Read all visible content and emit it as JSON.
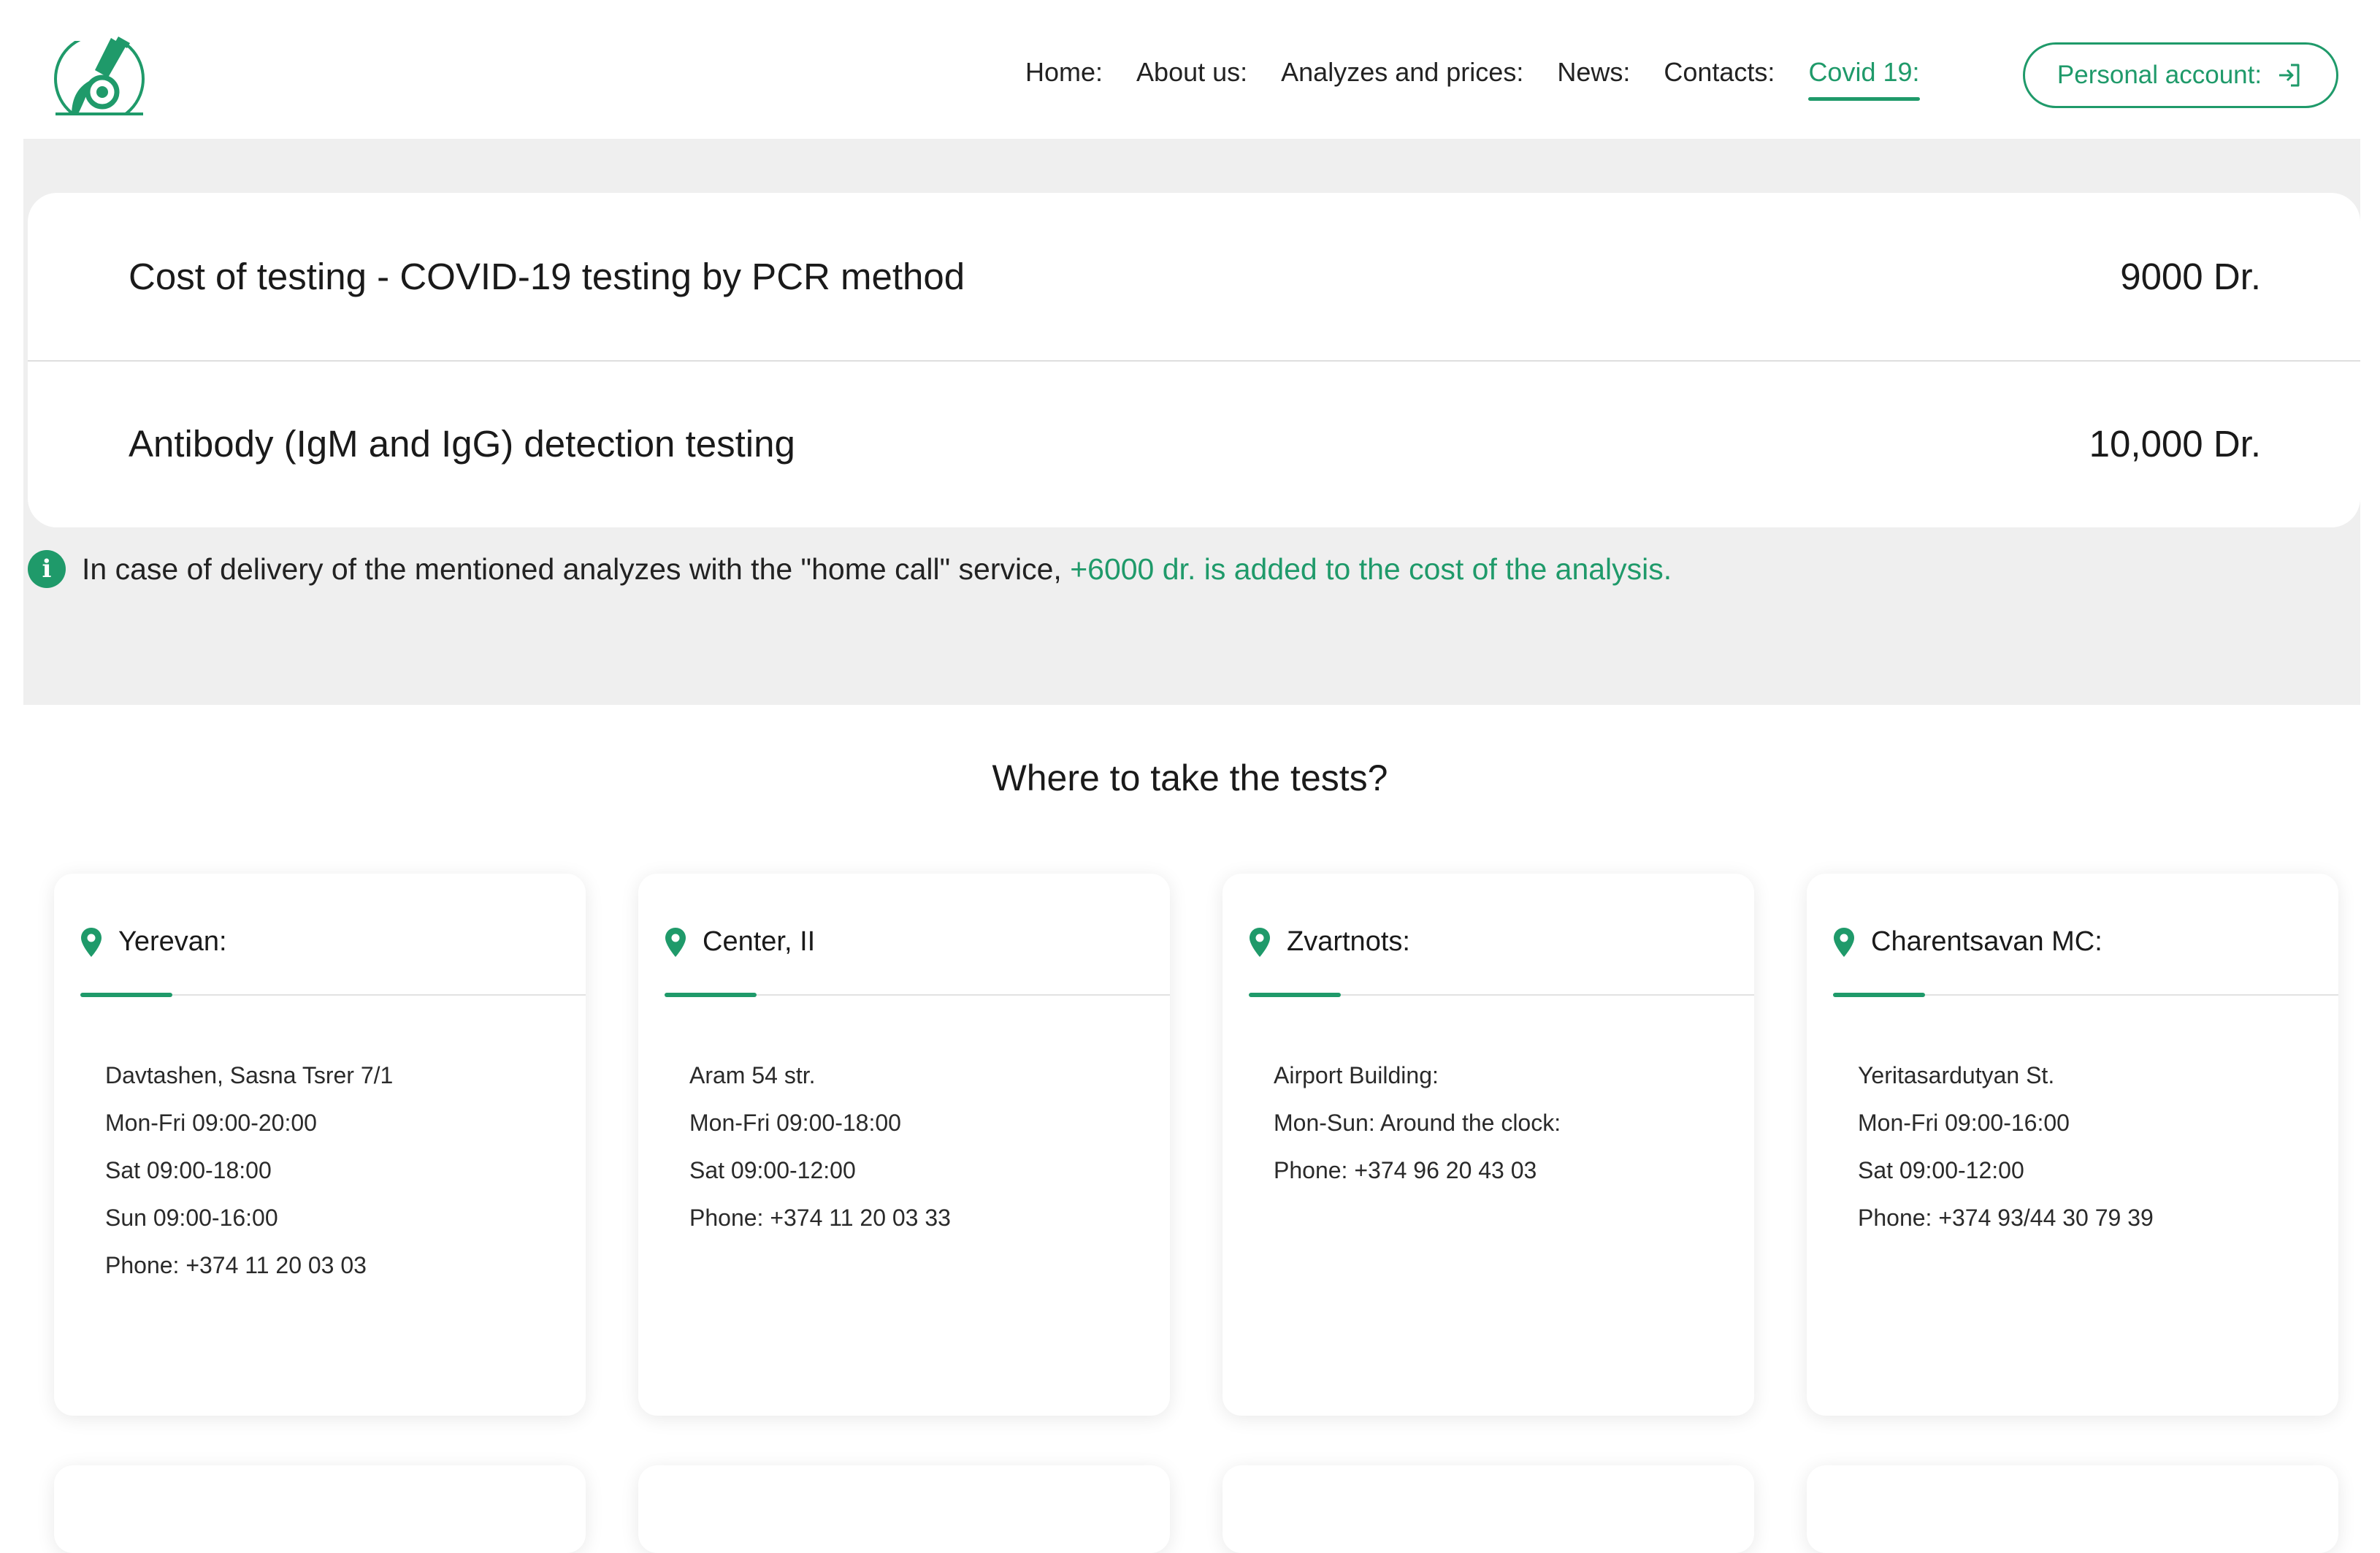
{
  "nav": {
    "items": [
      {
        "label": "Home:"
      },
      {
        "label": "About us:"
      },
      {
        "label": "Analyzes and prices:"
      },
      {
        "label": "News:"
      },
      {
        "label": "Contacts:"
      },
      {
        "label": "Covid 19:",
        "active": true
      }
    ],
    "account_label": "Personal account:"
  },
  "pricing": {
    "rows": [
      {
        "name": "Cost of testing - COVID-19 testing by PCR method",
        "price": "9000 Dr."
      },
      {
        "name": "Antibody (IgM and IgG) detection testing",
        "price": "10,000 Dr."
      }
    ],
    "note_text": "In case of delivery of the mentioned analyzes with the \"home call\" service,",
    "note_accent": "+6000 dr. is added to the cost of the analysis."
  },
  "locations": {
    "title": "Where to take the tests?",
    "cards": [
      {
        "name": "Yerevan:",
        "lines": [
          "Davtashen, Sasna Tsrer 7/1",
          "Mon-Fri 09:00-20:00",
          "Sat 09:00-18:00",
          "Sun 09:00-16:00",
          "Phone: +374 11 20 03 03"
        ]
      },
      {
        "name": "Center, II",
        "lines": [
          "Aram 54 str.",
          "Mon-Fri 09:00-18:00",
          "Sat 09:00-12:00",
          "Phone: +374 11 20 03 33"
        ]
      },
      {
        "name": "Zvartnots:",
        "lines": [
          "Airport Building:",
          "Mon-Sun: Around the clock:",
          "Phone: +374 96 20 43 03"
        ]
      },
      {
        "name": "Charentsavan MC:",
        "lines": [
          "Yeritasardutyan St.",
          "Mon-Fri 09:00-16:00",
          "Sat 09:00-12:00",
          "Phone: +374 93/44 30 79 39"
        ]
      }
    ]
  },
  "icons": {
    "logo": "microscope-logo-icon",
    "account": "login-arrow-icon",
    "info": "info-icon",
    "pin": "map-pin-icon"
  },
  "colors": {
    "accent": "#1f9a6a",
    "band_background": "#efefef"
  }
}
